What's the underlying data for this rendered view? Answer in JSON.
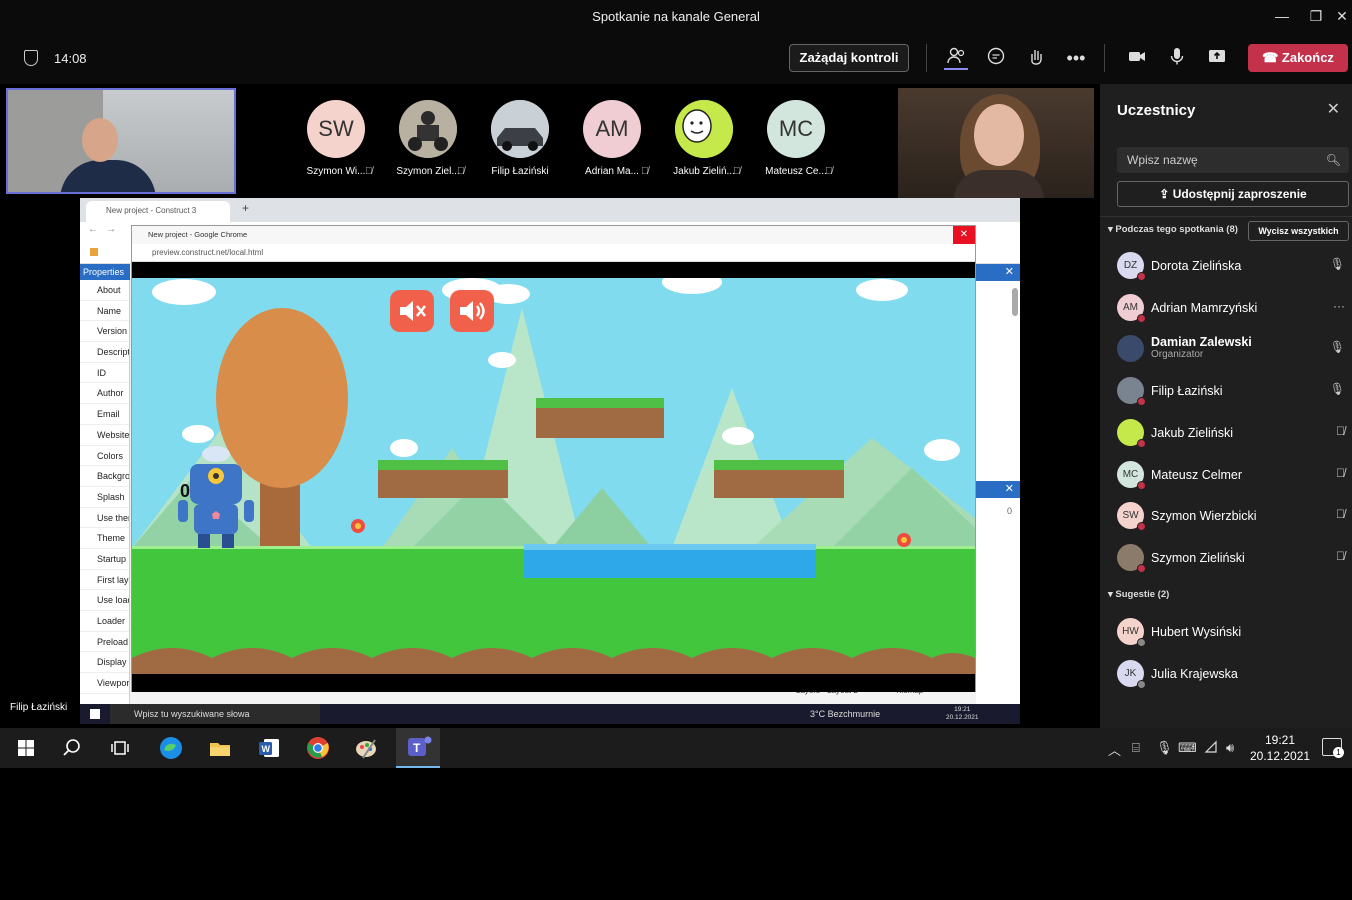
{
  "window": {
    "title": "Spotkanie na kanale General",
    "controls": [
      "—",
      "❐",
      "✕"
    ]
  },
  "toolbar": {
    "time": "14:08",
    "request_control": "Zażądaj kontroli",
    "end_call": "Zakończ",
    "end_color": "#c4314b"
  },
  "stage": {
    "participants": [
      {
        "initials": "SW",
        "name": "Szymon Wi...",
        "color": "#f4d3cc"
      },
      {
        "initials": "",
        "name": "Szymon Ziel...",
        "color": "#8a7b6a"
      },
      {
        "initials": "",
        "name": "Filip Łaziński",
        "color": "#9aa4ad"
      },
      {
        "initials": "AM",
        "name": "Adrian Ma...",
        "color": "#f0ccd3"
      },
      {
        "initials": "",
        "name": "Jakub Zieliń...",
        "color": "#c5e84a"
      },
      {
        "initials": "MC",
        "name": "Mateusz Ce...",
        "color": "#d3e6de"
      }
    ],
    "presenter_label": "Filip Łaziński"
  },
  "shared": {
    "chrome_tab": "New project - Construct 3",
    "popup_title": "New project - Google Chrome",
    "popup_url": "preview.construct.net/local.html",
    "score": "0",
    "properties_header": "Properties",
    "properties_rows": [
      "About",
      "Name",
      "Version",
      "Description",
      "ID",
      "Author",
      "Email",
      "Website",
      "Colors",
      "Background",
      "Splash",
      "Use theme",
      "Theme",
      "Startup",
      "First layout",
      "Use loader",
      "Loader",
      "Preload",
      "Display",
      "Viewport"
    ],
    "right_value": "0",
    "inner_search": "Wpisz tu wyszukiwane słowa",
    "inner_weather": "3°C Bezchmurnie",
    "inner_time": "19:21",
    "inner_date": "20.12.2021",
    "layers_label": "Layers - Layout 2",
    "tilemap_label": "Tilemap"
  },
  "sidebar": {
    "title": "Uczestnicy",
    "search_placeholder": "Wpisz nazwę",
    "invite": "Udostępnij zaproszenie",
    "in_meeting": "Podczas tego spotkania (8)",
    "remove_all": "Wycisz wszystkich",
    "participants": [
      {
        "initials": "DZ",
        "name": "Dorota Zielińska",
        "role": "",
        "color": "#d9d9f0",
        "icon": "mic"
      },
      {
        "initials": "AM",
        "name": "Adrian Mamrzyński",
        "role": "",
        "color": "#f0ccd3",
        "icon": "more"
      },
      {
        "initials": "",
        "name": "Damian Zalewski",
        "role": "Organizator",
        "color": "#3a4a6a",
        "icon": "mic"
      },
      {
        "initials": "",
        "name": "Filip Łaziński",
        "role": "",
        "color": "#7a8490",
        "icon": "mic"
      },
      {
        "initials": "",
        "name": "Jakub Zieliński",
        "role": "",
        "color": "#c5e84a",
        "icon": "mic-off"
      },
      {
        "initials": "MC",
        "name": "Mateusz Celmer",
        "role": "",
        "color": "#d3e6de",
        "icon": "mic-off"
      },
      {
        "initials": "SW",
        "name": "Szymon Wierzbicki",
        "role": "",
        "color": "#f4d3cc",
        "icon": "mic-off"
      },
      {
        "initials": "",
        "name": "Szymon Zieliński",
        "role": "",
        "color": "#8a7b6a",
        "icon": "mic-off"
      }
    ],
    "suggestions": "Sugestie (2)",
    "suggested": [
      {
        "initials": "HW",
        "name": "Hubert Wysiński",
        "color": "#f4d3cc"
      },
      {
        "initials": "JK",
        "name": "Julia Krajewska",
        "color": "#d9d9f0"
      }
    ]
  },
  "taskbar": {
    "time": "19:21",
    "date": "20.12.2021",
    "notif_count": "1"
  }
}
